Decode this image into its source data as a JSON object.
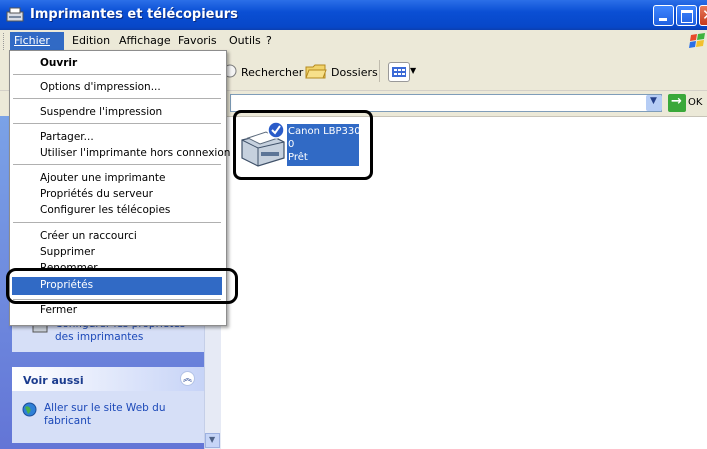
{
  "window": {
    "title": "Imprimantes et télécopieurs"
  },
  "menubar": {
    "items": [
      "Fichier",
      "Edition",
      "Affichage",
      "Favoris",
      "Outils",
      "?"
    ]
  },
  "toolbar": {
    "search_label": "Rechercher",
    "folders_label": "Dossiers"
  },
  "address": {
    "go_label": "OK"
  },
  "file_menu": {
    "items": [
      "Ouvrir",
      "Options d'impression...",
      "Suspendre l'impression",
      "Partager...",
      "Utiliser l'imprimante hors connexion",
      "Ajouter une imprimante",
      "Propriétés du serveur",
      "Configurer les télécopies",
      "Créer un raccourci",
      "Supprimer",
      "Renommer",
      "Propriétés",
      "Fermer"
    ]
  },
  "left_panel": {
    "partial_link_1": "Configurer les propriétés",
    "partial_link_2": "des imprimantes",
    "see_also_title": "Voir aussi",
    "see_also_link_1": "Aller sur le site Web du",
    "see_also_link_2": "fabricant"
  },
  "printer": {
    "name": "Canon LBP3300",
    "jobs": "0",
    "status": "Prêt"
  },
  "colors": {
    "titlebar": "#0a4fd4",
    "highlight": "#316ac5",
    "menu_bg": "#ece9d8"
  }
}
